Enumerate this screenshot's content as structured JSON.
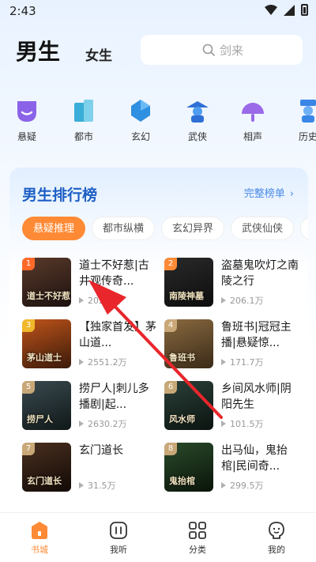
{
  "status_bar": {
    "time": "2:43"
  },
  "header": {
    "tab_male": "男生",
    "tab_female": "女生",
    "search_placeholder": "剑来"
  },
  "categories": [
    {
      "label": "悬疑",
      "icon": "mask-icon"
    },
    {
      "label": "都市",
      "icon": "building-icon"
    },
    {
      "label": "玄幻",
      "icon": "crystal-icon"
    },
    {
      "label": "武侠",
      "icon": "swordsman-icon"
    },
    {
      "label": "相声",
      "icon": "fan-icon"
    },
    {
      "label": "历史",
      "icon": "scholar-icon"
    }
  ],
  "ranking": {
    "title": "男生排行榜",
    "more_label": "完整榜单",
    "tabs": [
      "悬疑推理",
      "都市纵横",
      "玄幻异界",
      "武侠仙侠",
      "历"
    ],
    "active_tab": 0,
    "books": [
      {
        "rank": "1",
        "title": "道士不好惹|古井观传奇...",
        "plays": "202.8万",
        "cover_text": "道士不好惹"
      },
      {
        "rank": "2",
        "title": "盗墓鬼吹灯之南陵之行",
        "plays": "206.1万",
        "cover_text": "南陵神墓"
      },
      {
        "rank": "3",
        "title": "【独家首发】茅山道...",
        "plays": "2551.2万",
        "cover_text": "茅山道士"
      },
      {
        "rank": "4",
        "title": "鲁班书|冠冠主播|悬疑惊...",
        "plays": "171.7万",
        "cover_text": "鲁班书"
      },
      {
        "rank": "5",
        "title": "捞尸人|刺儿多播剧|起...",
        "plays": "2630.2万",
        "cover_text": "捞尸人"
      },
      {
        "rank": "6",
        "title": "乡间风水师|阴阳先生",
        "plays": "101.5万",
        "cover_text": "风水师"
      },
      {
        "rank": "7",
        "title": "玄门道长",
        "plays": "31.5万",
        "cover_text": "玄门道长"
      },
      {
        "rank": "8",
        "title": "出马仙，鬼抬棺|民间奇...",
        "plays": "299.5万",
        "cover_text": "鬼抬棺"
      }
    ]
  },
  "bottom_nav": [
    {
      "label": "书城",
      "icon": "bookstore-icon",
      "active": true
    },
    {
      "label": "我听",
      "icon": "listen-icon",
      "active": false
    },
    {
      "label": "分类",
      "icon": "grid-icon",
      "active": false
    },
    {
      "label": "我的",
      "icon": "profile-icon",
      "active": false
    }
  ],
  "colors": {
    "accent": "#ff8a35",
    "rank_title": "#1d5fc4",
    "annotation_arrow": "#e8262b"
  }
}
